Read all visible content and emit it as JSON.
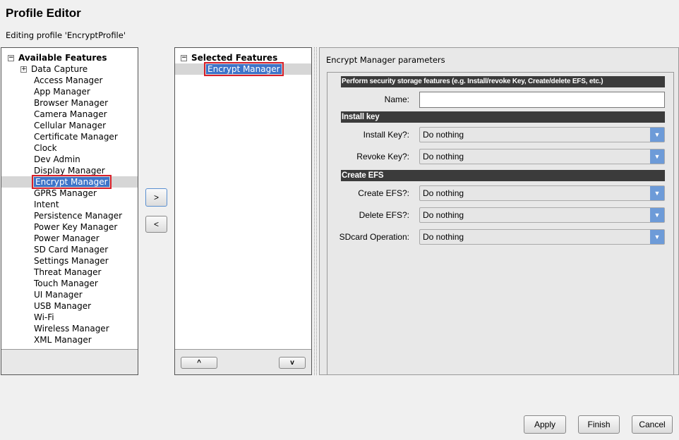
{
  "title": "Profile Editor",
  "subtitle": "Editing profile 'EncryptProfile'",
  "available": {
    "header": "Available Features",
    "items": [
      "Data Capture",
      "Access Manager",
      "App Manager",
      "Browser Manager",
      "Camera Manager",
      "Cellular Manager",
      "Certificate Manager",
      "Clock",
      "Dev Admin",
      "Display Manager",
      "Encrypt Manager",
      "GPRS Manager",
      "Intent",
      "Persistence Manager",
      "Power Key Manager",
      "Power Manager",
      "SD Card Manager",
      "Settings Manager",
      "Threat Manager",
      "Touch Manager",
      "UI Manager",
      "USB Manager",
      "Wi-Fi",
      "Wireless Manager",
      "XML Manager"
    ],
    "selected": "Encrypt Manager"
  },
  "transfer": {
    "add": ">",
    "remove": "<"
  },
  "selected": {
    "header": "Selected Features",
    "items": [
      "Encrypt Manager"
    ],
    "up": "^",
    "down": "v"
  },
  "params": {
    "title": "Encrypt Manager parameters",
    "description": "Perform security storage features (e.g. Install/revoke Key, Create/delete EFS, etc.)",
    "name_label": "Name:",
    "name_value": "",
    "section_install": "Install key",
    "section_efs": "Create EFS",
    "fields": [
      {
        "label": "Install Key?:",
        "value": "Do nothing"
      },
      {
        "label": "Revoke Key?:",
        "value": "Do nothing"
      },
      {
        "label": "Create EFS?:",
        "value": "Do nothing"
      },
      {
        "label": "Delete EFS?:",
        "value": "Do nothing"
      },
      {
        "label": "SDcard Operation:",
        "value": "Do nothing"
      }
    ]
  },
  "buttons": {
    "apply": "Apply",
    "finish": "Finish",
    "cancel": "Cancel"
  },
  "colors": {
    "selection": "#3d74c9",
    "highlight_border": "#d8202a",
    "header_bar": "#3b3b3b",
    "dropdown_arrow": "#6d9bd8"
  }
}
